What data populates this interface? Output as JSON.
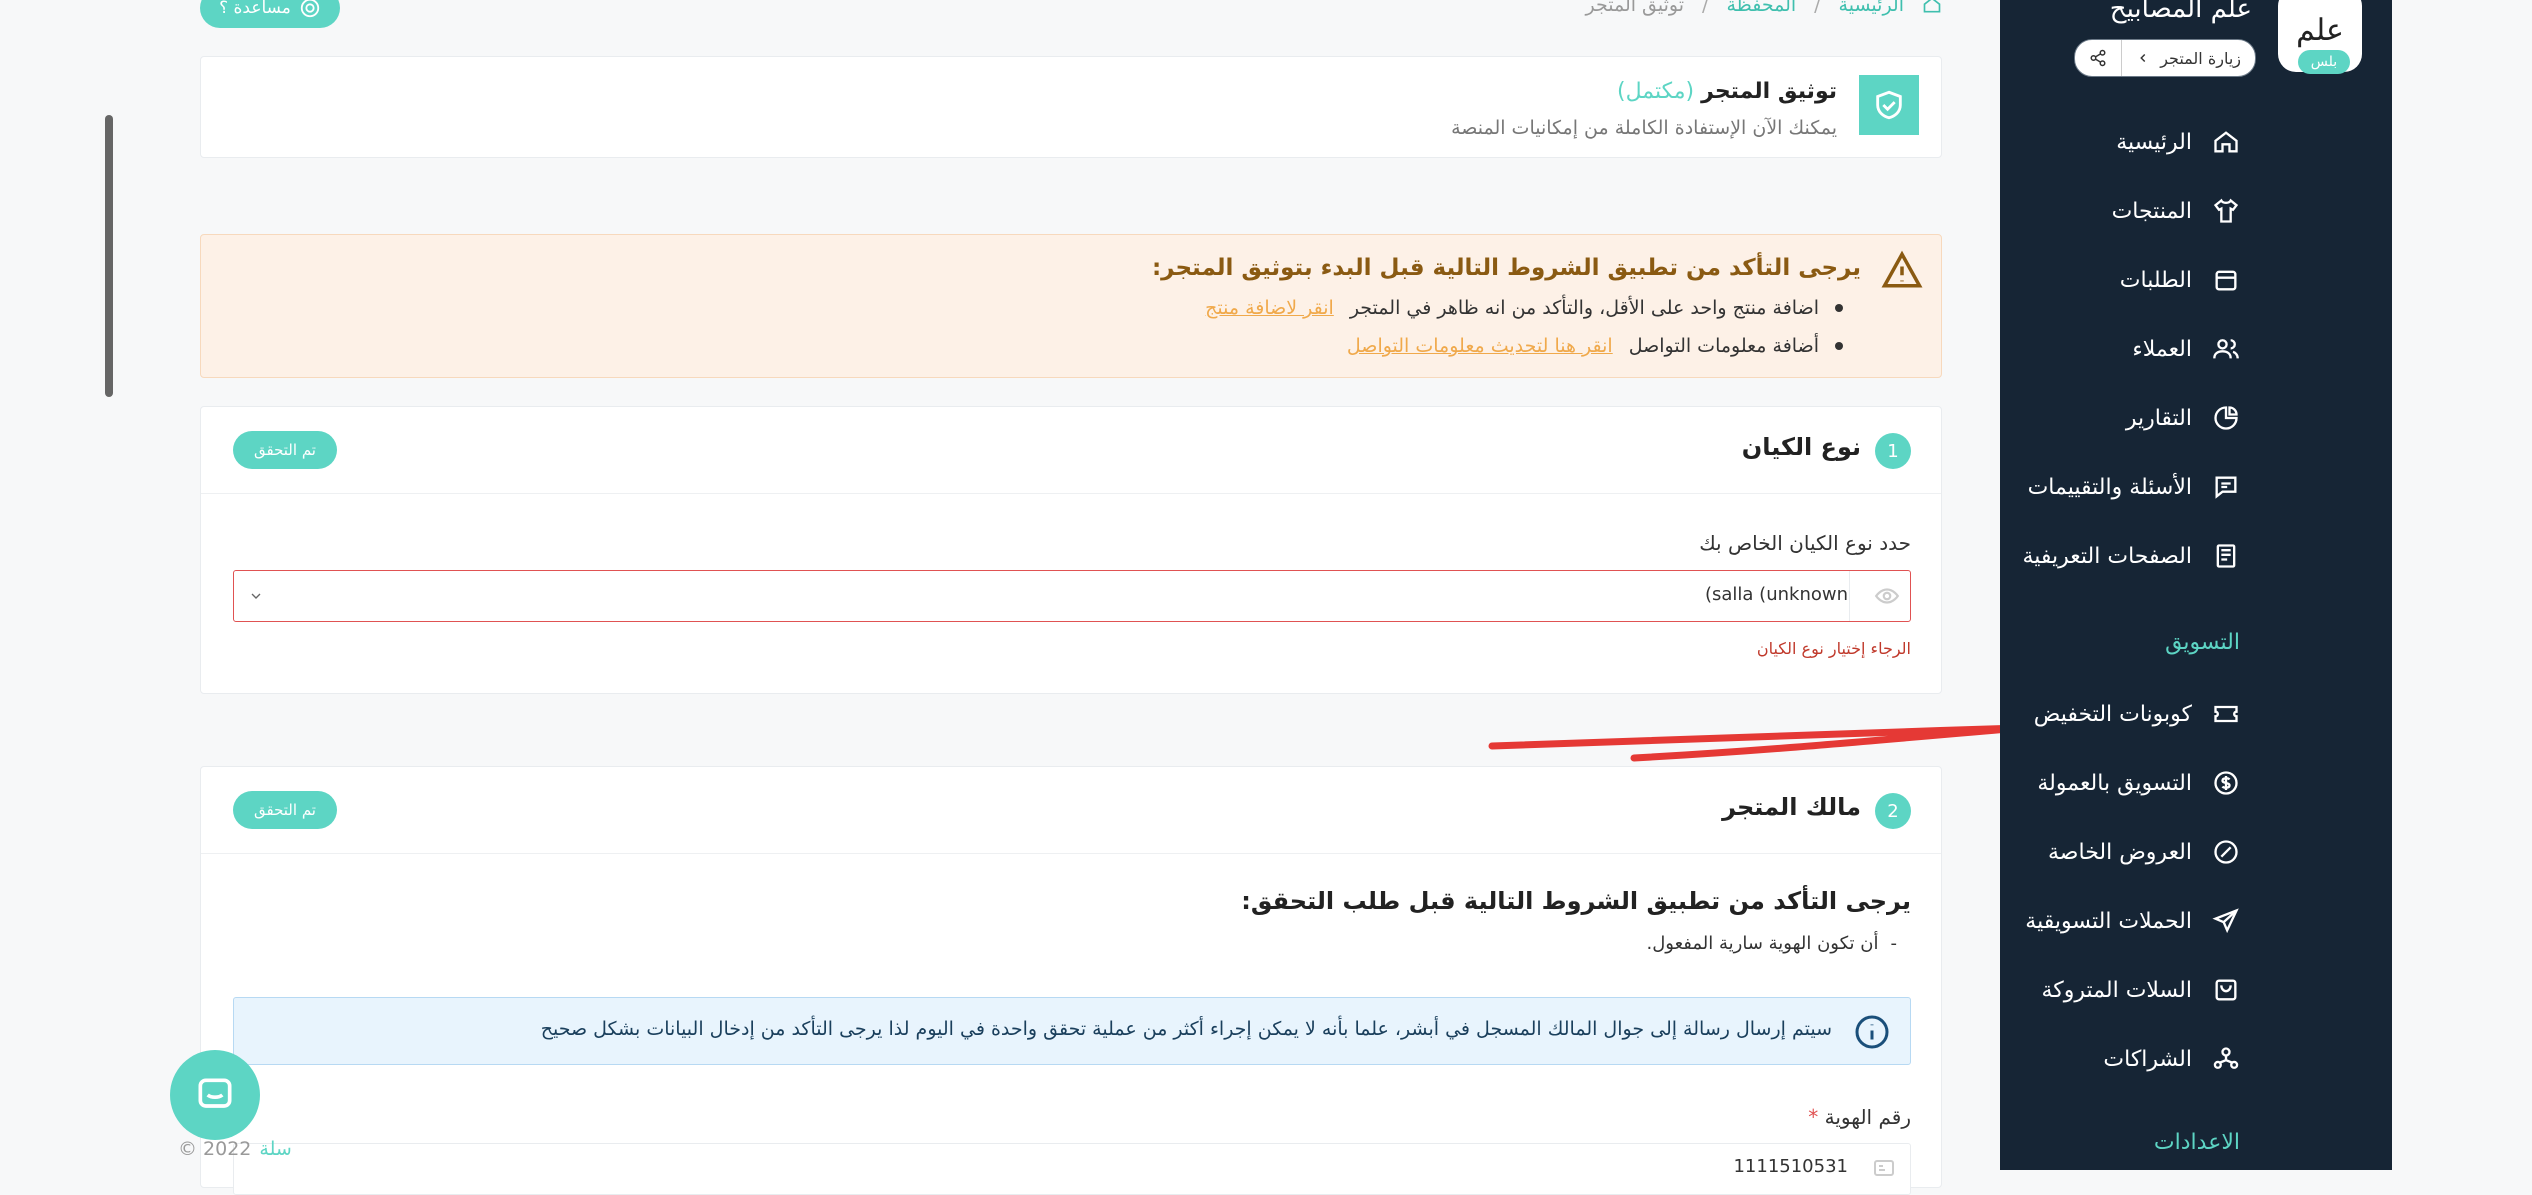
{
  "breadcrumb": {
    "home": "الرئيسية",
    "wallet": "المحفظة",
    "current": "توثيق المتجر",
    "separator": "/"
  },
  "help_button": {
    "label": "مساعدة ؟"
  },
  "store": {
    "name": "علم المصابيح",
    "plan_badge": "بلس",
    "visit_label": "زيارة المتجر",
    "logo_text": "علم"
  },
  "sidebar": {
    "items": [
      {
        "label": "الرئيسية",
        "icon": "home-icon"
      },
      {
        "label": "المنتجات",
        "icon": "shirt-icon"
      },
      {
        "label": "الطلبات",
        "icon": "box-icon"
      },
      {
        "label": "العملاء",
        "icon": "users-icon"
      },
      {
        "label": "التقارير",
        "icon": "pie-chart-icon"
      },
      {
        "label": "الأسئلة والتقييمات",
        "icon": "comment-icon"
      },
      {
        "label": "الصفحات التعريفية",
        "icon": "pages-icon"
      }
    ],
    "marketing_heading": "التسويق",
    "marketing_items": [
      {
        "label": "كوبونات التخفيض",
        "icon": "coupon-icon"
      },
      {
        "label": "التسويق بالعمولة",
        "icon": "dollar-icon"
      },
      {
        "label": "العروض الخاصة",
        "icon": "offer-icon"
      },
      {
        "label": "الحملات التسويقية",
        "icon": "send-icon"
      },
      {
        "label": "السلات المتروكة",
        "icon": "cart-icon"
      },
      {
        "label": "الشراكات",
        "icon": "partners-icon"
      }
    ],
    "settings_heading": "الاعدادات"
  },
  "verification": {
    "title": "توثيق المتجر",
    "status": "(مكتمل)",
    "subtitle": "يمكنك الآن الإستفادة الكاملة من إمكانيات المنصة"
  },
  "warning": {
    "title": "يرجى التأكد من تطبيق الشروط التالية قبل البدء بتوثيق المتجر:",
    "items": [
      {
        "text": "اضافة منتج واحد على الأقل، والتأكد من انه ظاهر في المتجر",
        "link": "انقر لاضافة منتج"
      },
      {
        "text": "أضافة معلومات التواصل",
        "link": "انقر هنا لتحديث معلومات التواصل"
      }
    ]
  },
  "entity": {
    "step": "1",
    "title": "نوع الكيان",
    "verified_label": "تم التحقق",
    "field_label": "حدد نوع الكيان الخاص بك",
    "select_value": "(salla (unknown",
    "error": "الرجاء إختيار نوع الكيان"
  },
  "owner": {
    "step": "2",
    "title": "مالك المتجر",
    "verified_label": "تم التحقق",
    "conditions_title": "يرجى التأكد من تطبيق الشروط التالية قبل طلب التحقق:",
    "condition": "أن تكون الهوية سارية المفعول.",
    "condition_dash": "-",
    "info": "سيتم إرسال رسالة إلى جوال المالك المسجل في أبشر، علما بأنه لا يمكن إجراء أكثر من عملية تحقق واحدة في اليوم لذا يرجى التأكد من إدخال البيانات بشكل صحيح",
    "id_label": "رقم الهوية",
    "required_mark": "*",
    "id_value": "1111510531"
  },
  "footer": {
    "brand": "سلة",
    "copyright": "© 2022"
  },
  "colors": {
    "sidebar": "#162535",
    "accent": "#5dd5c4",
    "warning_bg": "#fdf1e7",
    "error": "#e05252",
    "info_bg": "#e8f4fd"
  }
}
